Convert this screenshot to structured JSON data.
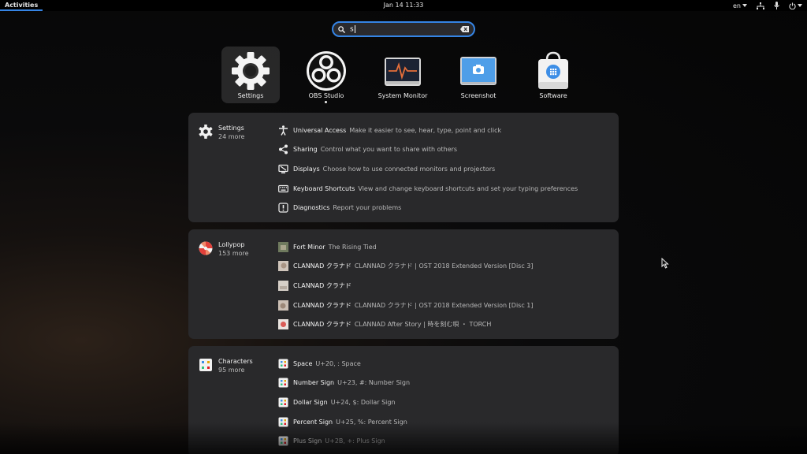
{
  "topbar": {
    "activities": "Activities",
    "clock": "Jan 14  11:33",
    "language": "en",
    "icons": [
      "network-icon",
      "microphone-icon",
      "power-icon"
    ]
  },
  "search": {
    "value": "s"
  },
  "apps": [
    {
      "label": "Settings",
      "icon": "gear-icon",
      "selected": true
    },
    {
      "label": "OBS Studio",
      "icon": "obs-icon",
      "running": true
    },
    {
      "label": "System Monitor",
      "icon": "system-monitor-icon"
    },
    {
      "label": "Screenshot",
      "icon": "screenshot-icon"
    },
    {
      "label": "Software",
      "icon": "software-bag-icon"
    }
  ],
  "providers": [
    {
      "name": "Settings",
      "more": "24 more",
      "icon": "gear-icon",
      "results": [
        {
          "title": "Universal Access",
          "desc": "Make it easier to see, hear, type, point and click",
          "icon": "accessibility-icon"
        },
        {
          "title": "Sharing",
          "desc": "Control what you want to share with others",
          "icon": "share-icon"
        },
        {
          "title": "Displays",
          "desc": "Choose how to use connected monitors and projectors",
          "icon": "display-icon"
        },
        {
          "title": "Keyboard Shortcuts",
          "desc": "View and change keyboard shortcuts and set your typing preferences",
          "icon": "keyboard-icon"
        },
        {
          "title": "Diagnostics",
          "desc": "Report your problems",
          "icon": "diagnostics-icon"
        }
      ]
    },
    {
      "name": "Lollypop",
      "more": "153 more",
      "icon": "lollypop-icon",
      "results": [
        {
          "title": "Fort Minor",
          "desc": "The Rising Tied",
          "icon": "album-cover-icon"
        },
        {
          "title": "CLANNAD クラナド",
          "desc": "CLANNAD クラナド | OST 2018 Extended Version [Disc 3]",
          "icon": "album-cover-icon"
        },
        {
          "title": "CLANNAD クラナド",
          "desc": "",
          "icon": "album-cover-icon"
        },
        {
          "title": "CLANNAD クラナド",
          "desc": "CLANNAD クラナド | OST 2018 Extended Version [Disc 1]",
          "icon": "album-cover-icon"
        },
        {
          "title": "CLANNAD クラナド",
          "desc": "CLANNAD After Story | 時を刻む唄 ・ TORCH",
          "icon": "album-cover-icon"
        }
      ]
    },
    {
      "name": "Characters",
      "more": "95 more",
      "icon": "characters-icon",
      "results": [
        {
          "title": "Space",
          "desc": "U+20, : Space",
          "icon": "character-icon"
        },
        {
          "title": "Number Sign",
          "desc": "U+23, #: Number Sign",
          "icon": "character-icon"
        },
        {
          "title": "Dollar Sign",
          "desc": "U+24, $: Dollar Sign",
          "icon": "character-icon"
        },
        {
          "title": "Percent Sign",
          "desc": "U+25, %: Percent Sign",
          "icon": "character-icon"
        },
        {
          "title": "Plus Sign",
          "desc": "U+2B, +: Plus Sign",
          "icon": "character-icon"
        }
      ]
    }
  ]
}
